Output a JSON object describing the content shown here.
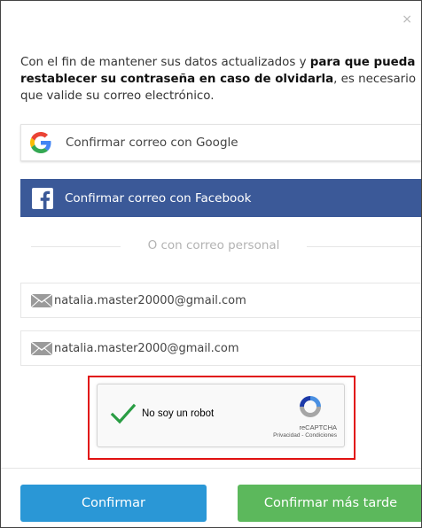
{
  "dialog": {
    "close_symbol": "×",
    "intro": {
      "line1_normal": "Con el fin de mantener sus datos actualizados y ",
      "line1_bold": "para que pueda",
      "line2_bold": "restablecer su contraseña en caso de olvidarla",
      "line2_normal": ", es necesario",
      "line3": "que valide su correo electrónico."
    }
  },
  "social": {
    "google_label": "Confirmar correo con Google",
    "google_icon": "google-g-icon",
    "facebook_label": "Confirmar correo con Facebook",
    "facebook_icon": "facebook-f-icon",
    "facebook_color": "#3b5998"
  },
  "separator": {
    "text": "O con correo personal"
  },
  "email_fields": {
    "email": "natalia.master20000@gmail.com",
    "confirm_email": "natalia.master2000@gmail.com",
    "icon": "envelope-icon"
  },
  "captcha": {
    "label": "No soy un robot",
    "brand": "reCAPTCHA",
    "terms": "Privacidad - Condiciones",
    "checked": true,
    "highlight_color": "#e11212"
  },
  "actions": {
    "confirm_label": "Confirmar",
    "later_label": "Confirmar más tarde",
    "confirm_color": "#2a97d6",
    "later_color": "#5cb85c"
  }
}
